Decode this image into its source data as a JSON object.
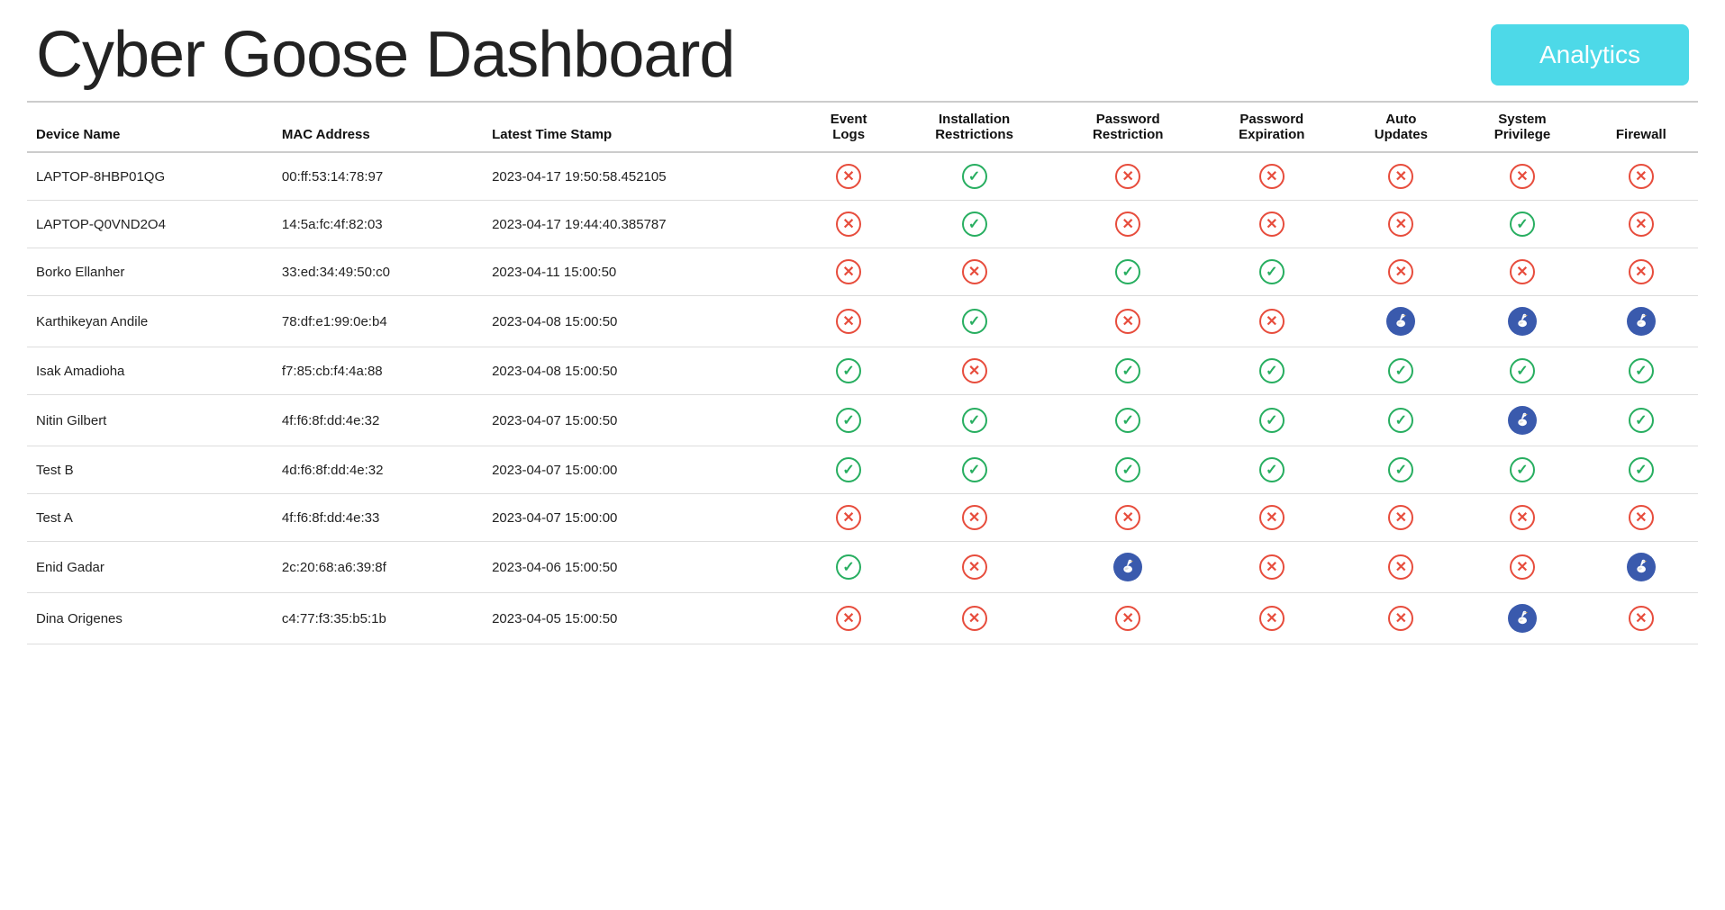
{
  "header": {
    "title": "Cyber Goose Dashboard",
    "analytics_label": "Analytics"
  },
  "table": {
    "columns": [
      {
        "key": "device_name",
        "label": "Device Name",
        "center": false
      },
      {
        "key": "mac_address",
        "label": "MAC Address",
        "center": false
      },
      {
        "key": "latest_time_stamp",
        "label": "Latest Time Stamp",
        "center": false
      },
      {
        "key": "event_logs",
        "label": "Event Logs",
        "center": true
      },
      {
        "key": "installation_restrictions",
        "label": "Installation Restrictions",
        "center": true
      },
      {
        "key": "password_restriction",
        "label": "Password Restriction",
        "center": true
      },
      {
        "key": "password_expiration",
        "label": "Password Expiration",
        "center": true
      },
      {
        "key": "auto_updates",
        "label": "Auto Updates",
        "center": true
      },
      {
        "key": "system_privilege",
        "label": "System Privilege",
        "center": true
      },
      {
        "key": "firewall",
        "label": "Firewall",
        "center": true
      }
    ],
    "rows": [
      {
        "device_name": "LAPTOP-8HBP01QG",
        "mac_address": "00:ff:53:14:78:97",
        "latest_time_stamp": "2023-04-17 19:50:58.452105",
        "event_logs": "x",
        "installation_restrictions": "check",
        "password_restriction": "x",
        "password_expiration": "x",
        "auto_updates": "x",
        "system_privilege": "x",
        "firewall": "x"
      },
      {
        "device_name": "LAPTOP-Q0VND2O4",
        "mac_address": "14:5a:fc:4f:82:03",
        "latest_time_stamp": "2023-04-17 19:44:40.385787",
        "event_logs": "x",
        "installation_restrictions": "check",
        "password_restriction": "x",
        "password_expiration": "x",
        "auto_updates": "x",
        "system_privilege": "check",
        "firewall": "x"
      },
      {
        "device_name": "Borko Ellanher",
        "mac_address": "33:ed:34:49:50:c0",
        "latest_time_stamp": "2023-04-11 15:00:50",
        "event_logs": "x",
        "installation_restrictions": "x",
        "password_restriction": "check",
        "password_expiration": "check",
        "auto_updates": "x",
        "system_privilege": "x",
        "firewall": "x"
      },
      {
        "device_name": "Karthikeyan Andile",
        "mac_address": "78:df:e1:99:0e:b4",
        "latest_time_stamp": "2023-04-08 15:00:50",
        "event_logs": "x",
        "installation_restrictions": "check",
        "password_restriction": "x",
        "password_expiration": "x",
        "auto_updates": "goose",
        "system_privilege": "goose",
        "firewall": "goose"
      },
      {
        "device_name": "Isak Amadioha",
        "mac_address": "f7:85:cb:f4:4a:88",
        "latest_time_stamp": "2023-04-08 15:00:50",
        "event_logs": "check",
        "installation_restrictions": "x",
        "password_restriction": "check",
        "password_expiration": "check",
        "auto_updates": "check",
        "system_privilege": "check",
        "firewall": "check"
      },
      {
        "device_name": "Nitin Gilbert",
        "mac_address": "4f:f6:8f:dd:4e:32",
        "latest_time_stamp": "2023-04-07 15:00:50",
        "event_logs": "check",
        "installation_restrictions": "check",
        "password_restriction": "check",
        "password_expiration": "check",
        "auto_updates": "check",
        "system_privilege": "goose",
        "firewall": "check"
      },
      {
        "device_name": "Test B",
        "mac_address": "4d:f6:8f:dd:4e:32",
        "latest_time_stamp": "2023-04-07 15:00:00",
        "event_logs": "check",
        "installation_restrictions": "check",
        "password_restriction": "check",
        "password_expiration": "check",
        "auto_updates": "check",
        "system_privilege": "check",
        "firewall": "check"
      },
      {
        "device_name": "Test A",
        "mac_address": "4f:f6:8f:dd:4e:33",
        "latest_time_stamp": "2023-04-07 15:00:00",
        "event_logs": "x",
        "installation_restrictions": "x",
        "password_restriction": "x",
        "password_expiration": "x",
        "auto_updates": "x",
        "system_privilege": "x",
        "firewall": "x"
      },
      {
        "device_name": "Enid Gadar",
        "mac_address": "2c:20:68:a6:39:8f",
        "latest_time_stamp": "2023-04-06 15:00:50",
        "event_logs": "check",
        "installation_restrictions": "x",
        "password_restriction": "goose",
        "password_expiration": "x",
        "auto_updates": "x",
        "system_privilege": "x",
        "firewall": "goose"
      },
      {
        "device_name": "Dina Origenes",
        "mac_address": "c4:77:f3:35:b5:1b",
        "latest_time_stamp": "2023-04-05 15:00:50",
        "event_logs": "x",
        "installation_restrictions": "x",
        "password_restriction": "x",
        "password_expiration": "x",
        "auto_updates": "x",
        "system_privilege": "goose",
        "firewall": "x"
      }
    ]
  }
}
